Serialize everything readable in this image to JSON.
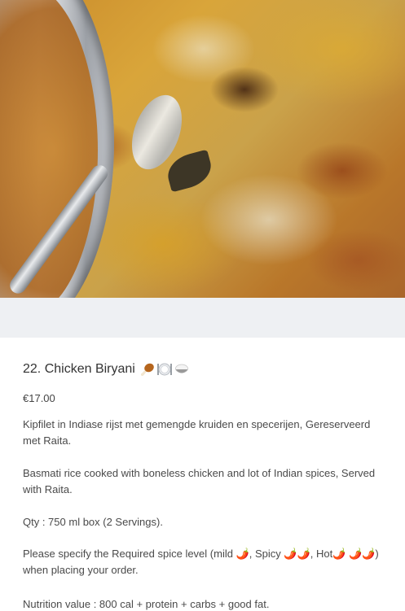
{
  "item": {
    "title": "22. Chicken Biryani",
    "title_icons": [
      "poultry-leg-icon",
      "plate-with-cutlery-icon",
      "rice-bowl-icon"
    ],
    "price": "€17.00",
    "description_nl": "Kipfilet in Indiase rijst met gemengde kruiden en specerijen, Gereserveerd met Raita.",
    "description_en": "Basmati rice cooked with boneless chicken and lot of Indian spices, Served with Raita.",
    "quantity": "Qty : 750 ml box (2 Servings).",
    "spice": {
      "prefix": "Please specify the Required spice level (mild ",
      "spicy": ", Spicy ",
      "hot": ", Hot",
      "suffix": ") when placing your order."
    },
    "nutrition": "Nutrition value : 800 cal + protein + carbs + good fat."
  },
  "colors": {
    "background": "#ffffff",
    "band": "#eef0f3",
    "text": "#333333",
    "chili": "#d62a1e"
  }
}
